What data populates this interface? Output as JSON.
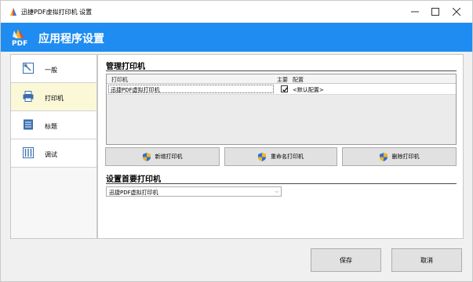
{
  "window": {
    "title": "迅捷PDF虚拟打印机 设置"
  },
  "banner": {
    "logo_text": "PDF",
    "title": "应用程序设置"
  },
  "nav": {
    "items": [
      {
        "label": "一般",
        "icon": "wrench-icon"
      },
      {
        "label": "打印机",
        "icon": "printer-icon",
        "active": true
      },
      {
        "label": "标题",
        "icon": "document-lines-icon"
      },
      {
        "label": "调试",
        "icon": "debug-icon"
      }
    ]
  },
  "manage_printers": {
    "title": "管理打印机",
    "columns": [
      "打印机",
      "主要",
      "配置"
    ],
    "rows": [
      {
        "printer": "迅捷PDF虚拟打印机",
        "primary": true,
        "config": "<默认配置>"
      }
    ],
    "buttons": {
      "add": "新增打印机",
      "rename": "重命名打印机",
      "delete": "删除打印机"
    }
  },
  "primary_printer": {
    "title": "设置首要打印机",
    "selected": "迅捷PDF虚拟打印机"
  },
  "footer": {
    "save": "保存",
    "cancel": "取消"
  },
  "colors": {
    "banner": "#1e8cf0",
    "active_nav": "#fbf8d8"
  }
}
